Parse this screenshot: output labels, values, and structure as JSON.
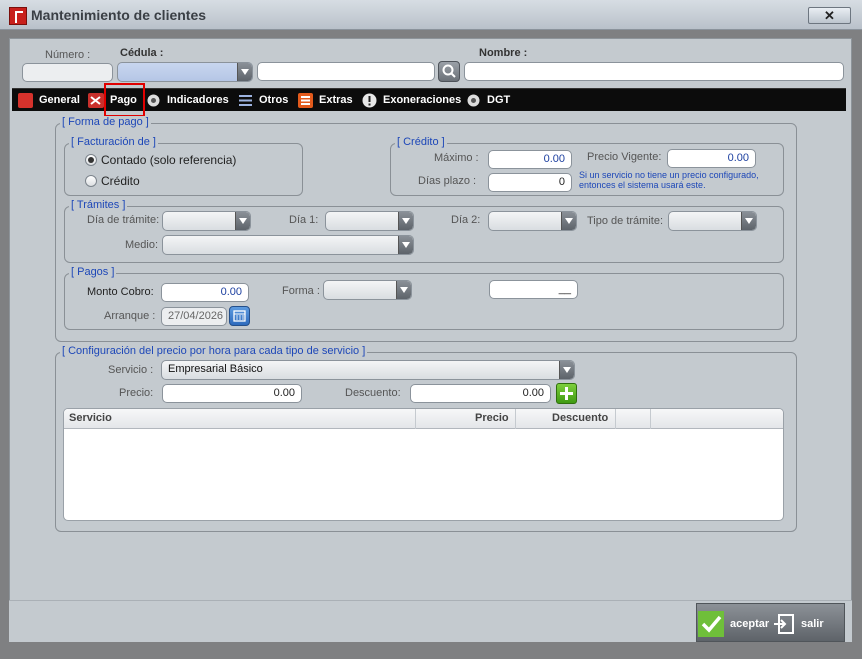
{
  "window": {
    "title": "Mantenimiento de clientes",
    "close_label": "✕"
  },
  "header": {
    "numero_label": "Número :",
    "cedula_label": "Cédula :",
    "nombre_label": "Nombre :"
  },
  "tabs": [
    {
      "label": "General",
      "icon": "store-icon"
    },
    {
      "label": "Pago",
      "icon": "shuffle-icon"
    },
    {
      "label": "Indicadores",
      "icon": "gear-icon"
    },
    {
      "label": "Otros",
      "icon": "list-icon"
    },
    {
      "label": "Extras",
      "icon": "list-icon"
    },
    {
      "label": "Exoneraciones",
      "icon": "info-icon"
    },
    {
      "label": "DGT",
      "icon": "gear-icon"
    }
  ],
  "forma_pago": {
    "legend": "[ Forma de pago ]",
    "facturacion": {
      "legend": "[ Facturación de ]",
      "option1": "Contado (solo referencia)",
      "option2": "Crédito"
    },
    "credito": {
      "legend": "[ Crédito ]",
      "maximo_label": "Máximo :",
      "maximo_value": "0.00",
      "dias_label": "Días plazo :",
      "dias_value": "0",
      "precio_vigente_label": "Precio Vigente:",
      "precio_vigente_value": "0.00",
      "note_line1": "Si un servicio no tiene un precio configurado,",
      "note_line2": "entonces el sistema usará este."
    },
    "tramites": {
      "legend": "[ Trámites ]",
      "dia_tramite_label": "Día de trámite:",
      "dia1_label": "Día 1:",
      "dia2_label": "Día 2:",
      "tipo_label": "Tipo de trámite:",
      "medio_label": "Medio:"
    },
    "pagos": {
      "legend": "[ Pagos ]",
      "monto_label": "Monto Cobro:",
      "monto_value": "0.00",
      "forma_label": "Forma :",
      "extra_value": "__",
      "arranque_label": "Arranque :",
      "arranque_value": "27/04/2026"
    }
  },
  "config": {
    "legend": "[ Configuración del precio por hora para cada tipo de servicio ]",
    "servicio_label": "Servicio :",
    "servicio_value": "Empresarial Básico",
    "precio_label": "Precio:",
    "precio_value": "0.00",
    "descuento_label": "Descuento:",
    "descuento_value": "0.00",
    "columns": [
      "Servicio",
      "Precio",
      "Descuento"
    ]
  },
  "footer": {
    "aceptar": "aceptar",
    "salir": "salir"
  },
  "colors": {
    "accent": "#1d47b8",
    "highlight": "#e00000",
    "tabbar": "#0c0c0c"
  }
}
